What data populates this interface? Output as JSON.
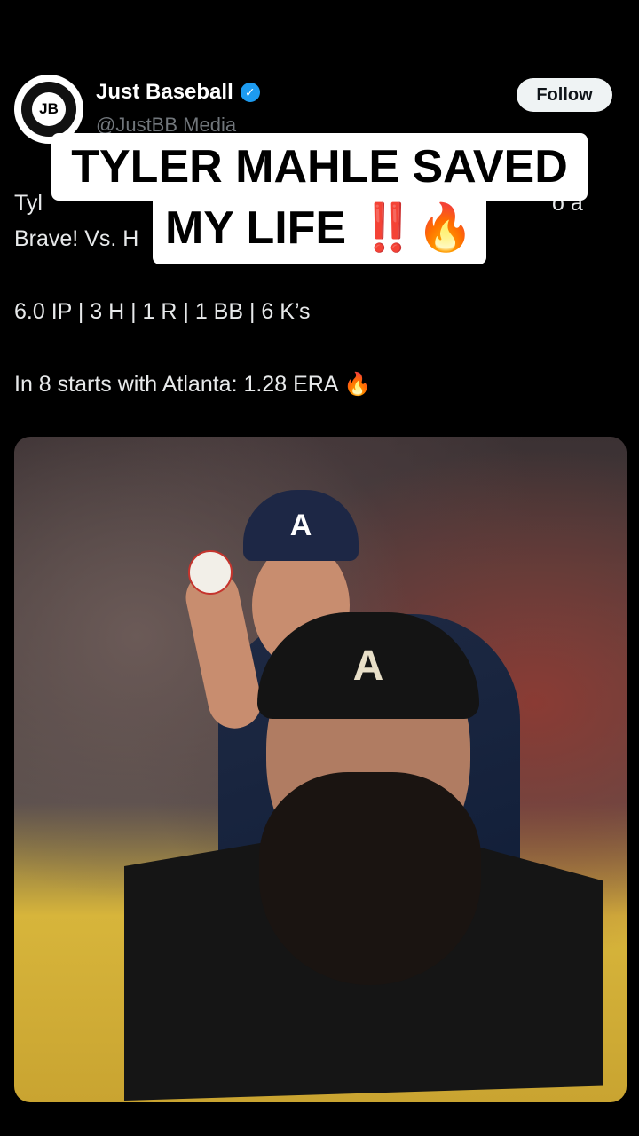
{
  "account": {
    "display_name": "Just Baseball",
    "handle": "@JustBB Media",
    "avatar_text": "JB",
    "follow_label": "Follow",
    "verified_color": "#1d9bf0"
  },
  "tweet": {
    "line1": "Tyl",
    "line1_tail": "o a",
    "line2": "Brave! Vs. H",
    "stats": "6.0 IP | 3 H | 1 R | 1 BB | 6 K’s",
    "atlanta": "In 8 starts with Atlanta: 1.28 ERA 🔥"
  },
  "overlay_caption": {
    "line1": "TYLER MAHLE SAVED",
    "line2": "MY LIFE ‼️🔥"
  },
  "media": {
    "cap_logo": "A",
    "beanie_logo": "A"
  }
}
